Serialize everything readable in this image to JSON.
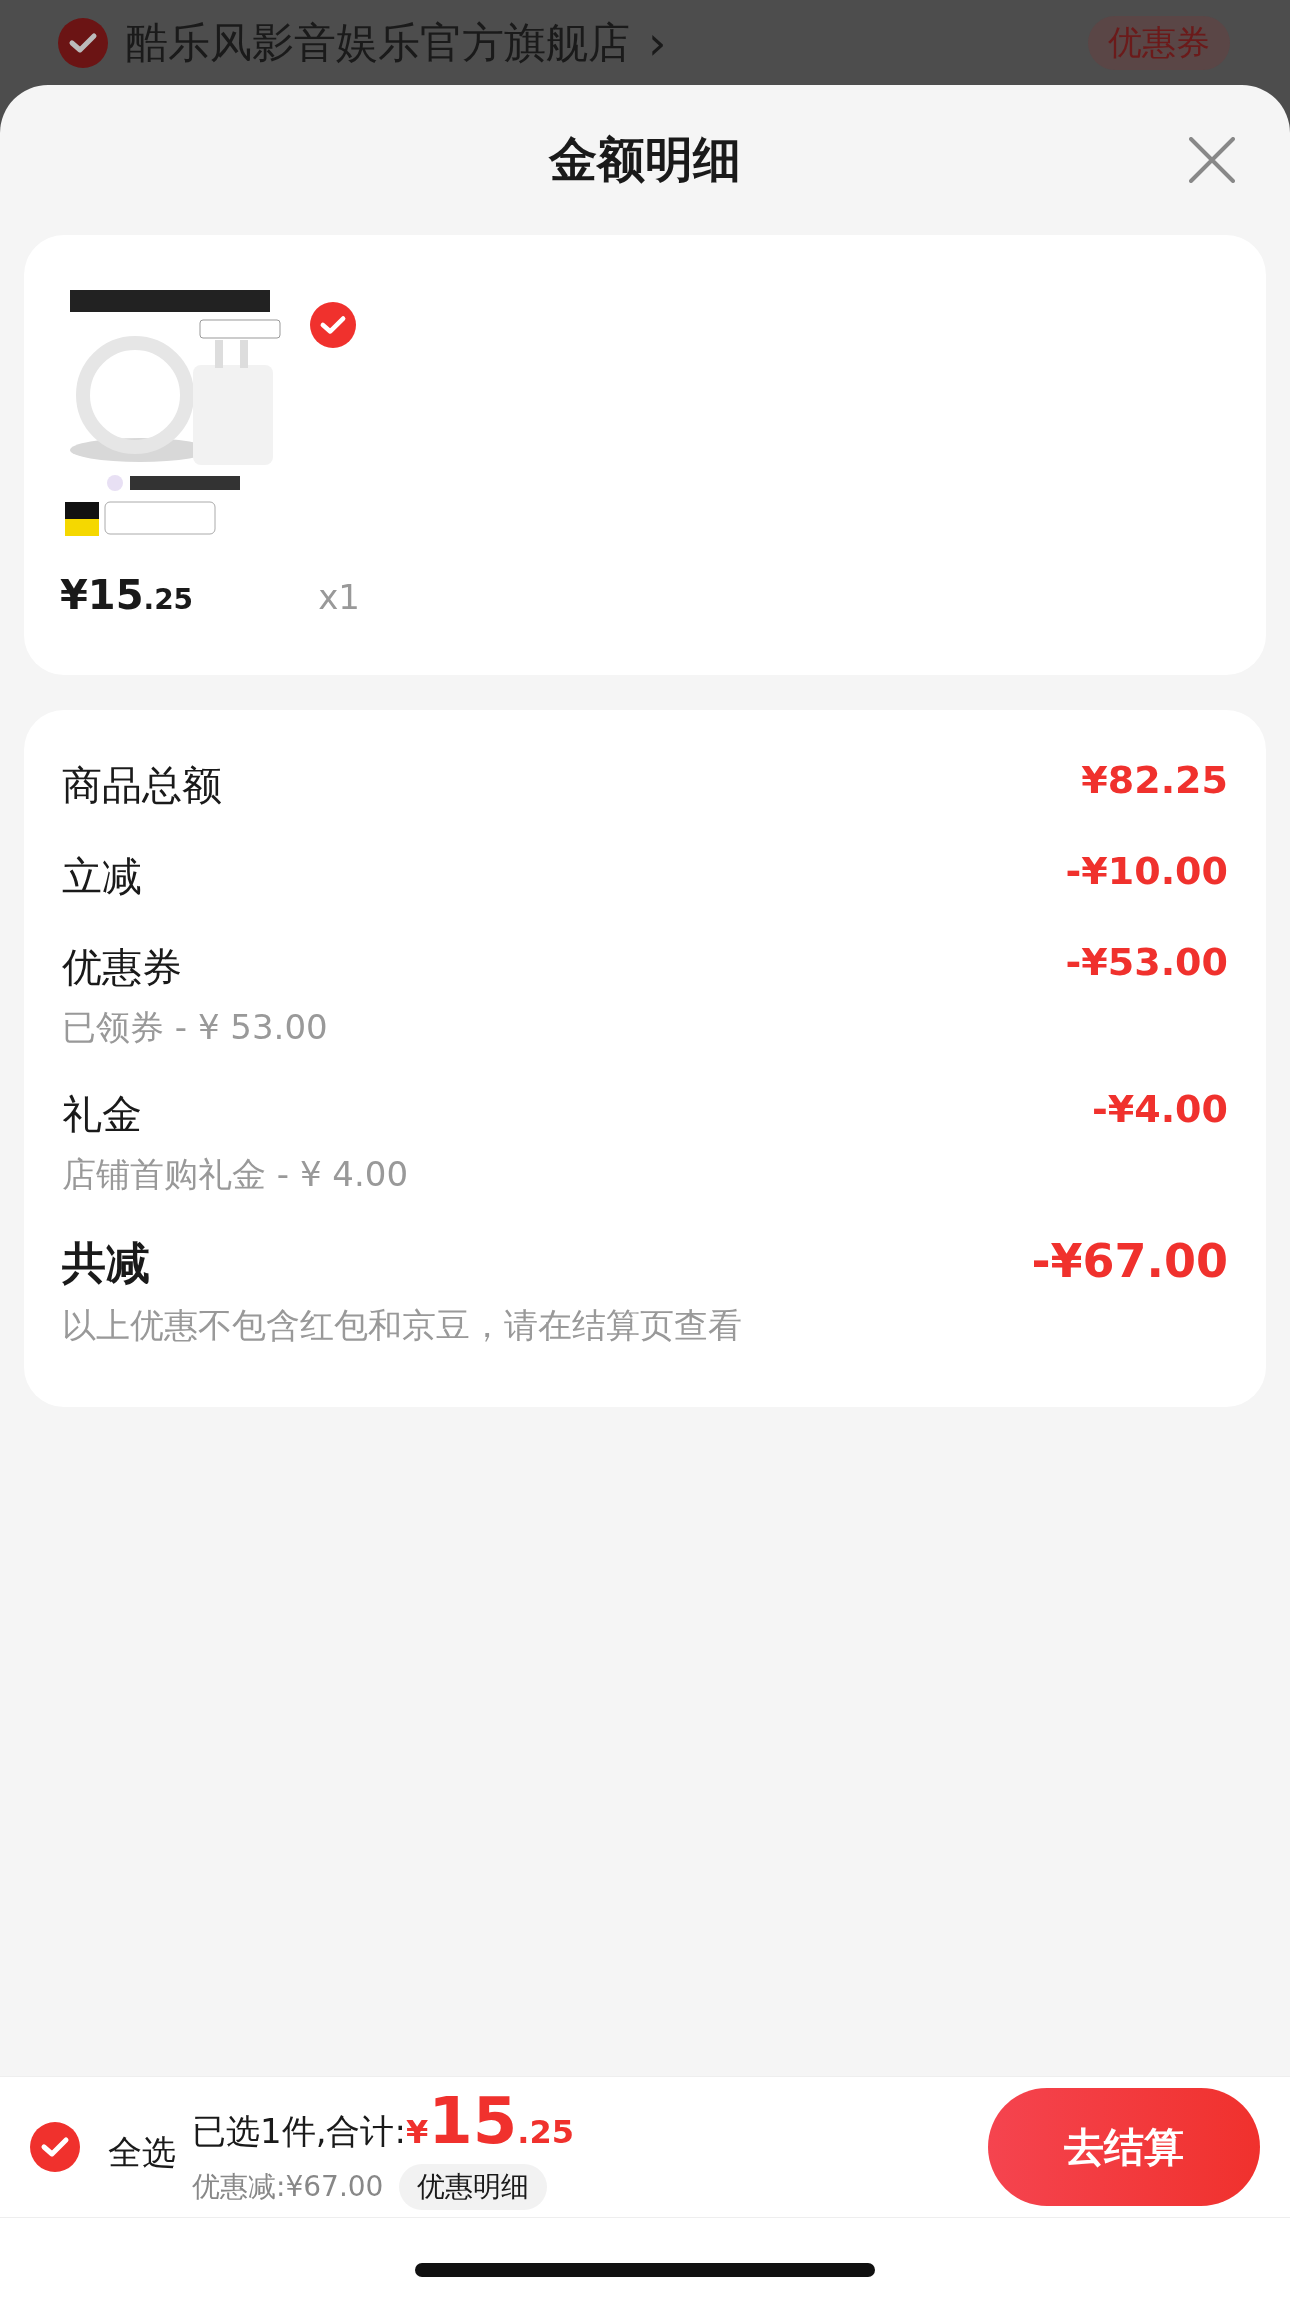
{
  "shop_header": {
    "checked": true,
    "name": "酷乐风影音娱乐官方旗舰店",
    "chevron": "›",
    "coupon_tag": "优惠券"
  },
  "sheet": {
    "title": "金额明细"
  },
  "items": [
    {
      "kind": "picture",
      "checked": true,
      "price_main": "¥15",
      "price_decimal": ".25",
      "quantity": "x1"
    }
  ],
  "summary": [
    {
      "kind": "row",
      "label": "商品总额",
      "amount": "¥82.25"
    },
    {
      "kind": "row",
      "label": "立减",
      "amount": "-¥10.00"
    },
    {
      "kind": "row",
      "label": "优惠券",
      "note": "已领券 - ¥ 53.00",
      "amount": "-¥53.00"
    },
    {
      "kind": "row",
      "label": "礼金",
      "note": "店铺首购礼金 - ¥ 4.00",
      "amount": "-¥4.00"
    },
    {
      "kind": "total",
      "label": "共减",
      "note": "以上优惠不包含红包和京豆，请在结算页查看",
      "amount": "-¥67.00"
    }
  ],
  "bottom_bar": {
    "select_all_checked": true,
    "select_all": "全选",
    "selected_text": "已选1件,合计:",
    "currency": "¥",
    "total_main": "15",
    "total_decimal": ".25",
    "discount_text": "优惠减:¥67.00",
    "details_button": "优惠明细",
    "checkout_button": "去结算"
  }
}
